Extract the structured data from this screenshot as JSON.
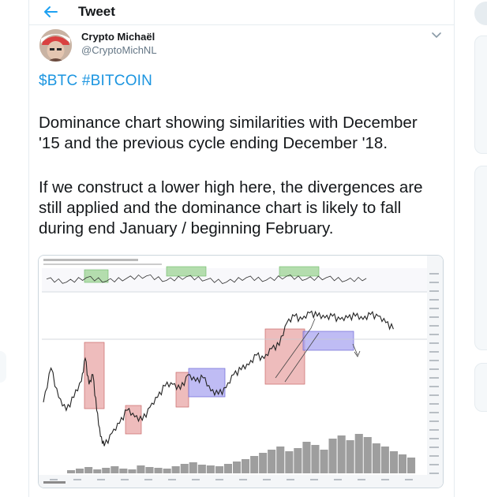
{
  "header": {
    "title": "Tweet"
  },
  "author": {
    "name": "Crypto Michaël",
    "handle": "@CryptoMichNL"
  },
  "tweet": {
    "tags": [
      "$BTC",
      "#BITCOIN"
    ],
    "paragraph1_lines": [
      "Dominance chart showing similarities with December",
      "'15 and the previous cycle ending December '18."
    ],
    "paragraph2_lines": [
      "If we construct a lower high here, the divergences are",
      "still applied and the dominance chart is likely to fall",
      "during end January / beginning February."
    ]
  },
  "chart_data": {
    "type": "line",
    "title": "",
    "note": "TradingView screenshot of a price line with an oscillator panel and volume bars; axis text is illegible",
    "series_color": "#222222",
    "highlight_colors": {
      "red_box": "#e8a5a5",
      "blue_box": "#a9a6f0",
      "green_box": "#a8d8a0"
    },
    "xlim": [
      0,
      100
    ],
    "ylim": [
      0,
      100
    ],
    "main_series": {
      "x": [
        0,
        2,
        4,
        6,
        8,
        10,
        11,
        12,
        13,
        14,
        15,
        16,
        18,
        20,
        22,
        24,
        26,
        28,
        30,
        32,
        34,
        36,
        38,
        40,
        42,
        44,
        46,
        48,
        50,
        52,
        54,
        56,
        58,
        60,
        62,
        64,
        66,
        68,
        70,
        72,
        74,
        76,
        78,
        80,
        82,
        84,
        86,
        88,
        90,
        92
      ],
      "y": [
        35,
        56,
        38,
        30,
        38,
        48,
        62,
        46,
        52,
        30,
        14,
        8,
        16,
        22,
        30,
        26,
        24,
        32,
        38,
        45,
        46,
        43,
        52,
        48,
        50,
        42,
        40,
        44,
        52,
        55,
        58,
        64,
        62,
        68,
        70,
        84,
        88,
        86,
        90,
        88,
        87,
        88,
        86,
        87,
        88,
        86,
        89,
        88,
        84,
        80
      ]
    },
    "oscillator": {
      "x": [
        0,
        6,
        12,
        18,
        24,
        30,
        36,
        42,
        48,
        54,
        60,
        66,
        72,
        78,
        84,
        90,
        96
      ],
      "y": [
        55,
        40,
        62,
        45,
        58,
        70,
        48,
        66,
        52,
        40,
        62,
        50,
        68,
        55,
        62,
        48,
        58
      ]
    },
    "volume": [
      4,
      6,
      8,
      5,
      7,
      9,
      6,
      5,
      10,
      8,
      7,
      6,
      9,
      12,
      14,
      11,
      10,
      9,
      12,
      15,
      18,
      22,
      26,
      30,
      34,
      28,
      32,
      40,
      36,
      30,
      44,
      48,
      42,
      50,
      46,
      38,
      34,
      28,
      24,
      20
    ]
  }
}
